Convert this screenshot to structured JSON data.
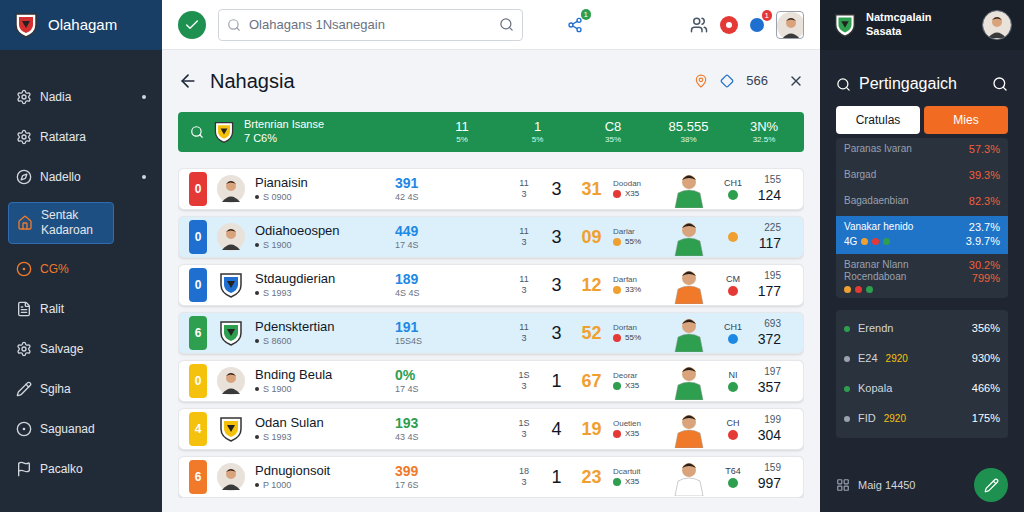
{
  "sidebar": {
    "brand": "Olahagam",
    "items": [
      {
        "label": "Nadia",
        "dot": true,
        "selected": false,
        "accent": false
      },
      {
        "label": "Ratatara",
        "dot": false,
        "selected": false,
        "accent": false
      },
      {
        "label": "Nadello",
        "dot": true,
        "selected": false,
        "accent": false
      },
      {
        "label": "Sentak Kadaroan",
        "dot": false,
        "selected": true,
        "accent": false
      },
      {
        "label": "CG%",
        "dot": false,
        "selected": false,
        "accent": true
      },
      {
        "label": "Ralit",
        "dot": false,
        "selected": false,
        "accent": false
      },
      {
        "label": "Salvage",
        "dot": false,
        "selected": false,
        "accent": false
      },
      {
        "label": "Sgiha",
        "dot": false,
        "selected": false,
        "accent": false
      },
      {
        "label": "Saguanad",
        "dot": false,
        "selected": false,
        "accent": false
      },
      {
        "label": "Pacalko",
        "dot": false,
        "selected": false,
        "accent": false
      }
    ]
  },
  "topbar": {
    "search": {
      "placeholder": "Olahagans 1Nsanegain"
    },
    "badges": [
      "1",
      "1"
    ]
  },
  "page": {
    "title": "Nahagsia",
    "count": "566"
  },
  "summary": {
    "name": "Brtenrian Isanse",
    "sub": "7 C6%",
    "stats": [
      {
        "value": "11",
        "sub": "5%"
      },
      {
        "value": "1",
        "sub": "5%"
      },
      {
        "value": "C8",
        "sub": "35%"
      },
      {
        "value": "85.555",
        "sub": "38%"
      },
      {
        "value": "3N%",
        "sub": "32.5%"
      }
    ]
  },
  "table": {
    "rows": [
      {
        "rank": "0",
        "color": "#e53935",
        "avatar": "person",
        "name": "Pianaisin",
        "sub": "S 0900",
        "value": "391",
        "value_color": "#1e88e5",
        "value_sub": "42 4S",
        "small_top": "11",
        "small_bottom": "3",
        "count": "3",
        "score": "31",
        "status": "Doodan",
        "status_sub": "X35",
        "status_color": "#e53935",
        "shirt": "#2e9e4f",
        "code": "CH1",
        "code_color": "#2e9e4f",
        "top": "155",
        "bottom": "124",
        "selected": false
      },
      {
        "rank": "0",
        "color": "#1e6fd0",
        "avatar": "person",
        "name": "Odiahoeospen",
        "sub": "S 1900",
        "value": "449",
        "value_color": "#1e88e5",
        "value_sub": "17 4S",
        "small_top": "11",
        "small_bottom": "3",
        "count": "3",
        "score": "09",
        "status": "Darlar",
        "status_sub": "55%",
        "status_color": "#f0a030",
        "shirt": "#2e9e4f",
        "code_color": "#f0a030",
        "top": "225",
        "bottom": "117",
        "selected": true
      },
      {
        "rank": "0",
        "color": "#1e6fd0",
        "avatar": "crest",
        "name": "Stdaugdierian",
        "sub": "S 1993",
        "value": "189",
        "value_color": "#1e88e5",
        "value_sub": "4S 4S",
        "small_top": "11",
        "small_bottom": "3",
        "count": "3",
        "score": "12",
        "status": "Darfan",
        "status_sub": "33%",
        "status_color": "#f0a030",
        "shirt": "#f07a2a",
        "code": "CM",
        "code_color": "#e53935",
        "top": "195",
        "bottom": "177",
        "selected": false
      },
      {
        "rank": "6",
        "color": "#2e9e4f",
        "avatar": "crest",
        "name": "Pdensktertian",
        "sub": "S 8600",
        "value": "191",
        "value_color": "#1e88e5",
        "value_sub": "15S4S",
        "small_top": "11",
        "small_bottom": "3",
        "count": "3",
        "score": "52",
        "status": "Dortan",
        "status_sub": "55%",
        "status_color": "#e53935",
        "shirt": "#2e9e4f",
        "code": "CH1",
        "code_color": "#1e88e5",
        "top": "693",
        "bottom": "372",
        "selected": true
      },
      {
        "rank": "0",
        "color": "#f4c20d",
        "avatar": "person",
        "name": "Bnding Beula",
        "sub": "S 1900",
        "value": "0%",
        "value_color": "#2e9e4f",
        "value_sub": "17 4S",
        "small_top": "1S",
        "small_bottom": "3",
        "count": "1",
        "score": "67",
        "status": "Deorar",
        "status_sub": "X35",
        "status_color": "#2e9e4f",
        "shirt": "#2e9e4f",
        "code": "NI",
        "code_color": "#2e9e4f",
        "top": "197",
        "bottom": "357",
        "selected": false
      },
      {
        "rank": "4",
        "color": "#f4c20d",
        "avatar": "crest",
        "name": "Odan Sulan",
        "sub": "S 1993",
        "value": "193",
        "value_color": "#2e9e4f",
        "value_sub": "43 4S",
        "small_top": "1S",
        "small_bottom": "3",
        "count": "4",
        "score": "19",
        "status": "Ouetien",
        "status_sub": "X35",
        "status_color": "#e53935",
        "shirt": "#f07a2a",
        "code": "CH",
        "code_color": "#e53935",
        "top": "199",
        "bottom": "304",
        "selected": false
      },
      {
        "rank": "6",
        "color": "#f07a2a",
        "avatar": "person",
        "name": "Pdnugionsoit",
        "sub": "P 1000",
        "value": "399",
        "value_color": "#f07a2a",
        "value_sub": "17 6S",
        "small_top": "18",
        "small_bottom": "3",
        "count": "1",
        "score": "23",
        "status": "Dcartuit",
        "status_sub": "X35",
        "status_color": "#2e9e4f",
        "shirt": "#ffffff",
        "code": "T64",
        "code_color": "#2e9e4f",
        "top": "159",
        "bottom": "997",
        "selected": false
      }
    ]
  },
  "right_panel": {
    "org": "Natmcgalain",
    "org_sub": "Sasata",
    "title": "Pertingagaich",
    "tabs": [
      {
        "label": "Cratulas",
        "selected": false
      },
      {
        "label": "Mies",
        "selected": true
      }
    ],
    "list": [
      {
        "label": "Paranas Ivaran",
        "value": "57.3%",
        "selected": false
      },
      {
        "label": "Bargad",
        "value": "39.3%",
        "selected": false
      },
      {
        "label": "Bagadaenbian",
        "value": "82.3%",
        "selected": false
      },
      {
        "label": "Vanakar henido",
        "value": "23.7%",
        "tag": "4G",
        "sub": "3.9.7%",
        "selected": true
      },
      {
        "label": "Baranar Nlann Rocendaboan",
        "value": "30.2%",
        "sub": "799%",
        "selected": false
      }
    ],
    "stats": [
      {
        "label": "Erendn",
        "value": "356%"
      },
      {
        "label": "E24",
        "tag": "2920",
        "value": "930%"
      },
      {
        "label": "Kopala",
        "value": "466%"
      },
      {
        "label": "FID",
        "tag": "2920",
        "value": "175%"
      }
    ],
    "footer": "Maig 14450"
  }
}
